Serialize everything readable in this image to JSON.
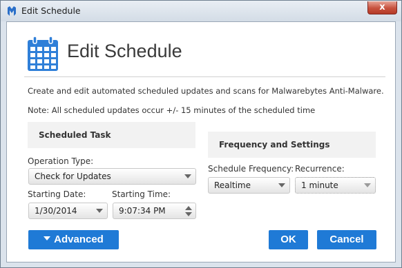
{
  "window": {
    "title": "Edit Schedule",
    "close_glyph": "x"
  },
  "header": {
    "title": "Edit Schedule",
    "icon": "calendar-icon"
  },
  "description": "Create and edit automated scheduled updates and scans for Malwarebytes Anti-Malware.",
  "note": "Note: All scheduled updates occur +/- 15 minutes of the scheduled time",
  "scheduled_task": {
    "heading": "Scheduled Task",
    "operation_type_label": "Operation Type:",
    "operation_type_value": "Check for Updates",
    "starting_date_label": "Starting Date:",
    "starting_date_value": "1/30/2014",
    "starting_time_label": "Starting Time:",
    "starting_time_value": "9:07:34 PM"
  },
  "frequency": {
    "heading": "Frequency and Settings",
    "schedule_frequency_label": "Schedule Frequency:",
    "schedule_frequency_value": "Realtime",
    "recurrence_label": "Recurrence:",
    "recurrence_value": "1 minute"
  },
  "buttons": {
    "advanced": "Advanced",
    "ok": "OK",
    "cancel": "Cancel"
  },
  "colors": {
    "accent": "#1f7ad6",
    "close_red": "#c7513e"
  }
}
